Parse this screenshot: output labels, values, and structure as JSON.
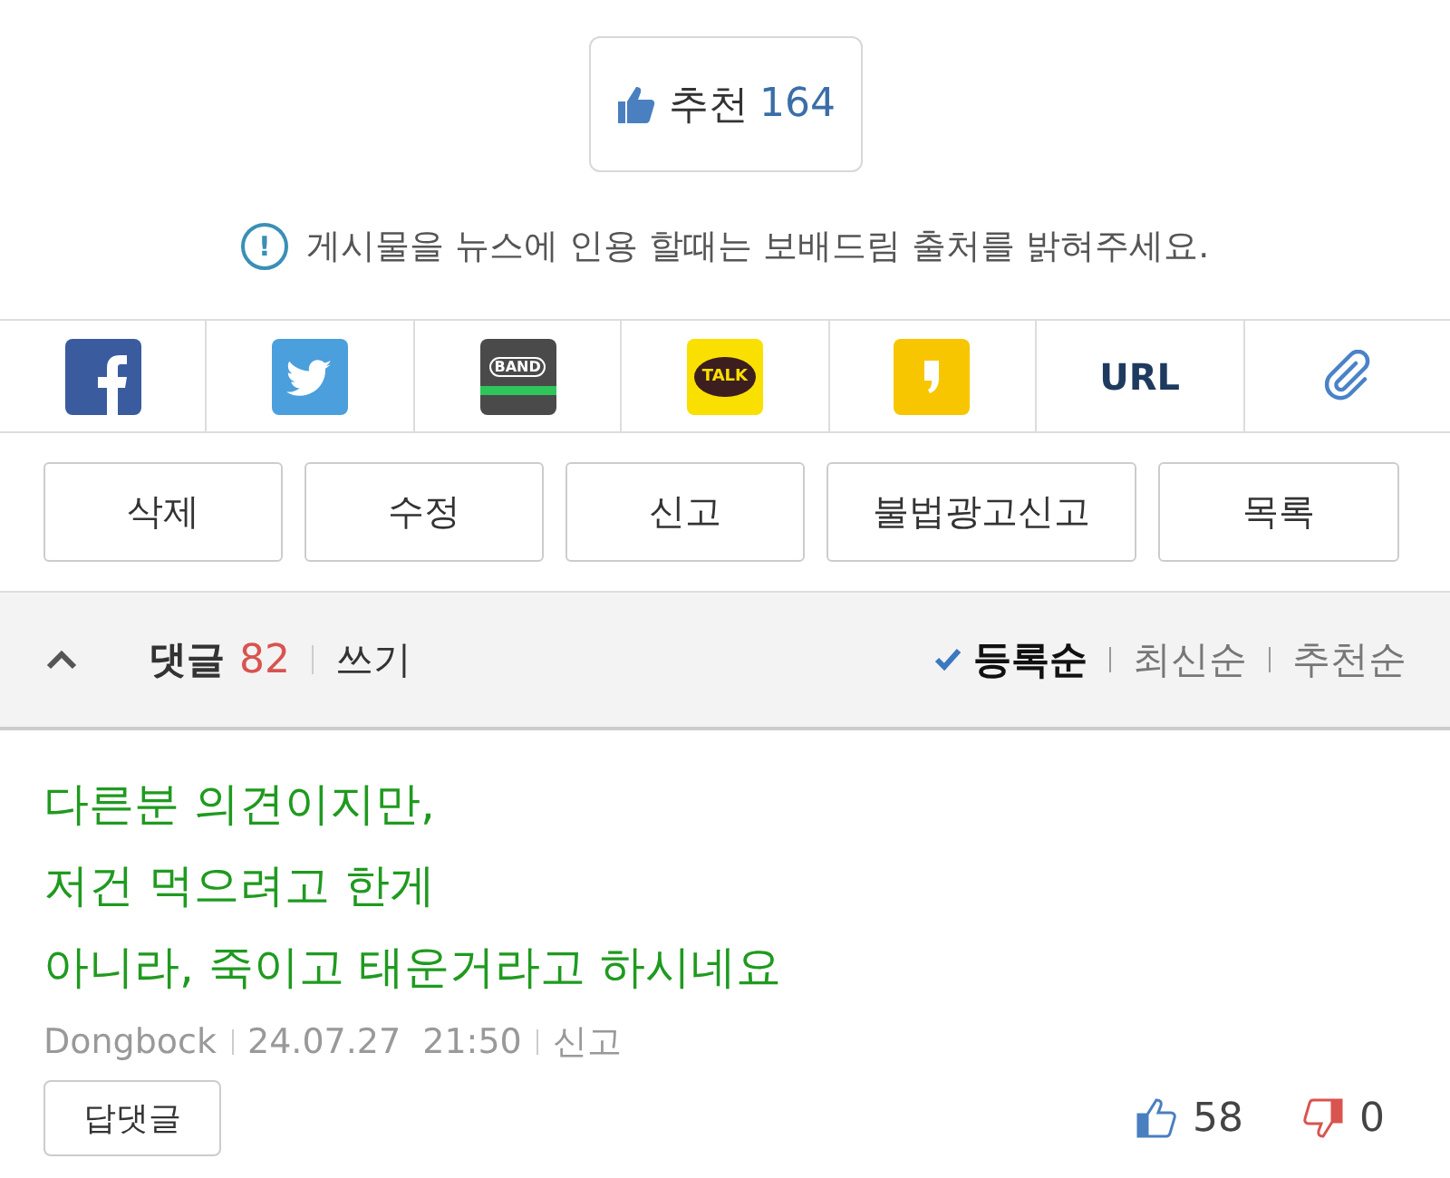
{
  "recommend": {
    "label": "추천",
    "count": "164"
  },
  "notice": {
    "icon": "!",
    "text": "게시물을 뉴스에 인용 할때는 보배드림 출처를 밝혀주세요."
  },
  "share": [
    {
      "kind": "facebook"
    },
    {
      "kind": "twitter"
    },
    {
      "kind": "band",
      "label": "BAND"
    },
    {
      "kind": "talk",
      "label": "TALK"
    },
    {
      "kind": "story"
    },
    {
      "kind": "url",
      "label": "URL"
    },
    {
      "kind": "clip"
    }
  ],
  "actions": [
    "삭제",
    "수정",
    "신고",
    "불법광고신고",
    "목록"
  ],
  "comments_header": {
    "expanded": true,
    "label": "댓글",
    "count": "82",
    "write": "쓰기",
    "sort": [
      {
        "label": "등록순",
        "selected": true
      },
      {
        "label": "최신순",
        "selected": false
      },
      {
        "label": "추천순",
        "selected": false
      }
    ]
  },
  "comment": {
    "text": "다른분 의견이지만,\n저건 먹으려고 한게\n아니라, 죽이고 태운거라고 하시네요",
    "author": "Dongbock",
    "date": "24.07.27",
    "time": "21:50",
    "report": "신고",
    "reply": "답댓글",
    "likes": "58",
    "dislikes": "0"
  }
}
